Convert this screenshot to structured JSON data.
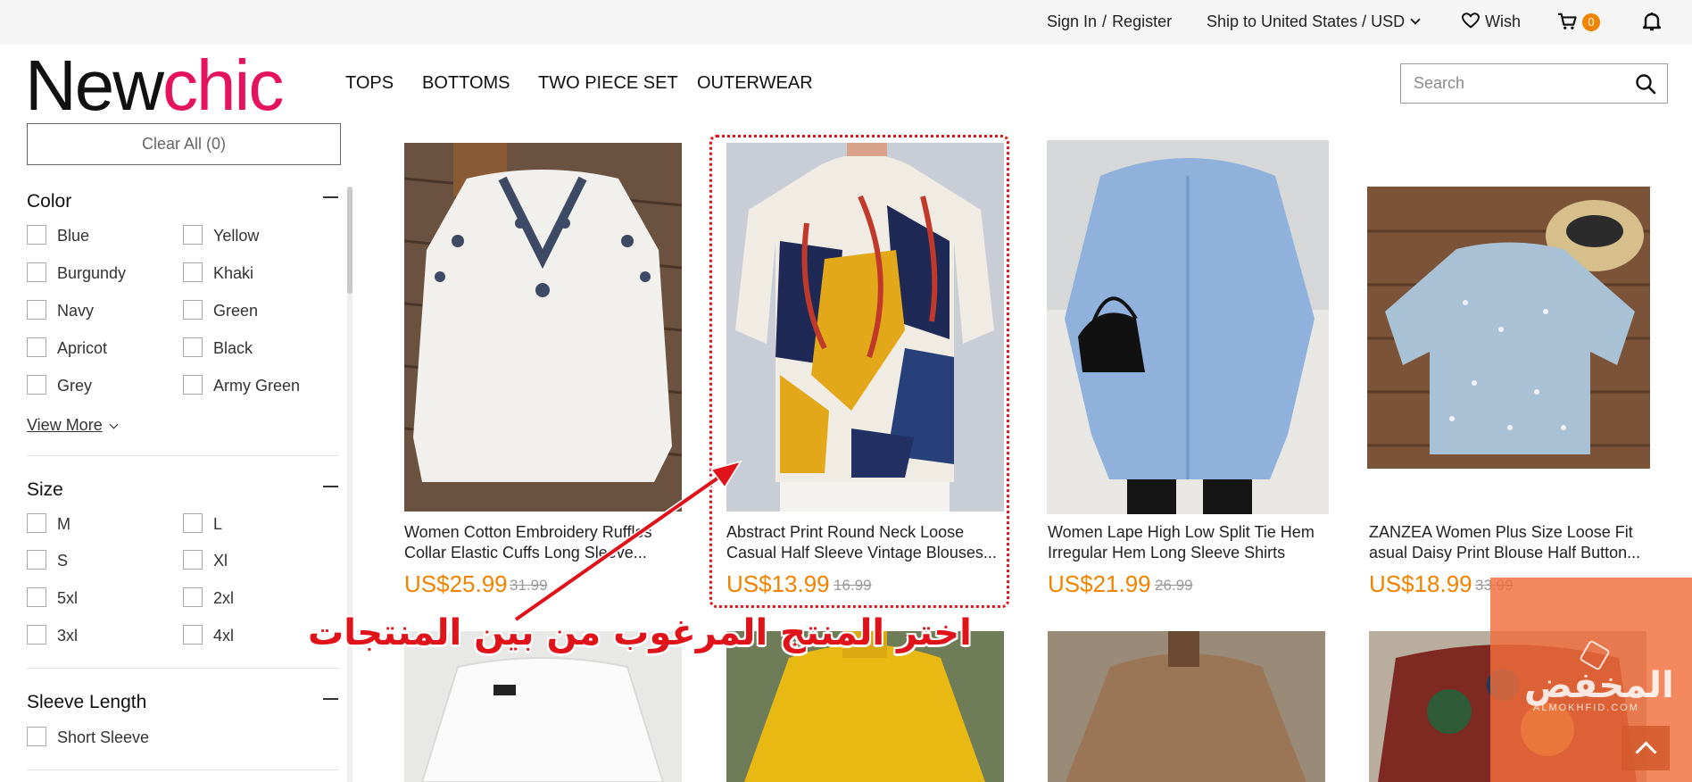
{
  "topbar": {
    "sign_in": "Sign In",
    "separator": "/",
    "register": "Register",
    "ship_to": "Ship to United States / USD",
    "wish": "Wish",
    "cart_count": "0"
  },
  "header": {
    "logo_part1": "New",
    "logo_part2": "chic",
    "nav": [
      "TOPS",
      "BOTTOMS",
      "TWO PIECE SET",
      "OUTERWEAR"
    ],
    "search_placeholder": "Search"
  },
  "sidebar": {
    "clear_all": "Clear All (0)",
    "color": {
      "title": "Color",
      "options_left": [
        "Blue",
        "Burgundy",
        "Navy",
        "Apricot",
        "Grey"
      ],
      "options_right": [
        "Yellow",
        "Khaki",
        "Green",
        "Black",
        "Army Green"
      ],
      "view_more": "View More"
    },
    "size": {
      "title": "Size",
      "options_left": [
        "M",
        "S",
        "5xl",
        "3xl"
      ],
      "options_right": [
        "L",
        "Xl",
        "2xl",
        "4xl"
      ]
    },
    "sleeve": {
      "title": "Sleeve Length",
      "options": [
        "Short Sleeve"
      ]
    }
  },
  "products": [
    {
      "title": "Women Cotton Embroidery Ruffles Collar Elastic Cuffs Long Sleeve...",
      "price": "US$25.99",
      "old_price": "31.99"
    },
    {
      "title": "Abstract Print Round Neck Loose Casual Half Sleeve Vintage Blouses...",
      "price": "US$13.99",
      "old_price": "16.99"
    },
    {
      "title": "Women Lape High Low Split Tie Hem Irregular Hem Long Sleeve Shirts",
      "price": "US$21.99",
      "old_price": "26.99"
    },
    {
      "title": "ZANZEA Women Plus Size Loose Fit asual Daisy Print Blouse Half Button...",
      "price": "US$18.99",
      "old_price": "33.99"
    }
  ],
  "annotation": "اختر المنتج المرغوب من بين المنتجات",
  "watermark": {
    "name": "المخفض",
    "site": "ALMOKHFID.COM"
  },
  "colors": {
    "brand_pink": "#e5125e",
    "price_orange": "#f08300",
    "annotation_red": "#e0131a"
  },
  "icons": [
    "chevron-down-icon",
    "heart-icon",
    "cart-icon",
    "bell-icon",
    "search-icon",
    "minus-icon",
    "arrow-up-icon"
  ]
}
